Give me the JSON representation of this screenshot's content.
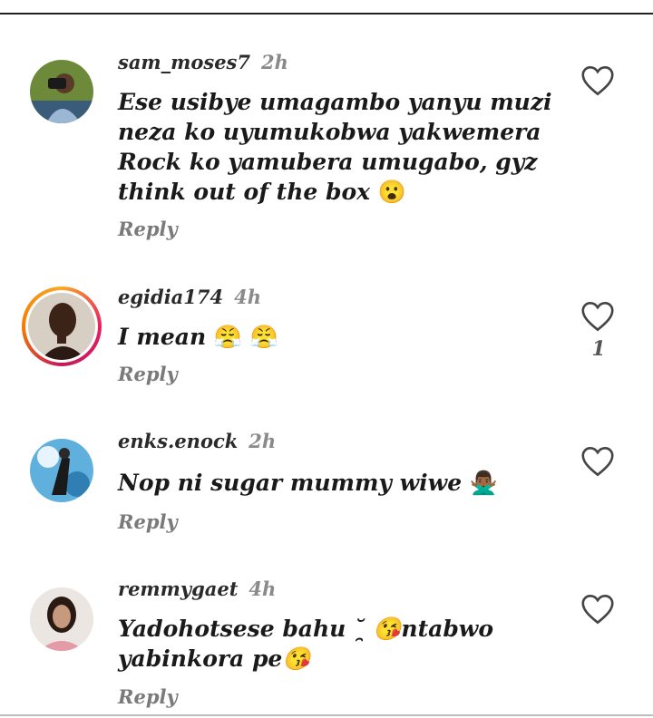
{
  "comments": [
    {
      "username": "sam_moses7",
      "time": "2h",
      "text": "Ese usibye umagambo yanyu muzi neza ko uyumukobwa yakwemera Rock ko yamubera umugabo, gyz think out of the box",
      "emoji": "😮",
      "reply": "Reply",
      "likes": ""
    },
    {
      "username": "egidia174",
      "time": "4h",
      "text": "I mean",
      "emoji": "😤 😤",
      "reply": "Reply",
      "likes": "1"
    },
    {
      "username": "enks.enock",
      "time": "2h",
      "text": "Nop ni sugar mummy wiwe",
      "emoji": "🙅🏾‍♂️",
      "reply": "Reply",
      "likes": ""
    },
    {
      "username": "remmygaet",
      "time": "4h",
      "text": "Yadohotsese bahu ˘̯ 😘ntabwo yabinkora pe😘",
      "emoji": "",
      "reply": "Reply",
      "likes": ""
    }
  ],
  "icons": {
    "like": "heart-outline-icon"
  },
  "colors": {
    "reply": "#7a7a7a",
    "time": "#8a8a8a",
    "story_ring": "#e91e63"
  }
}
